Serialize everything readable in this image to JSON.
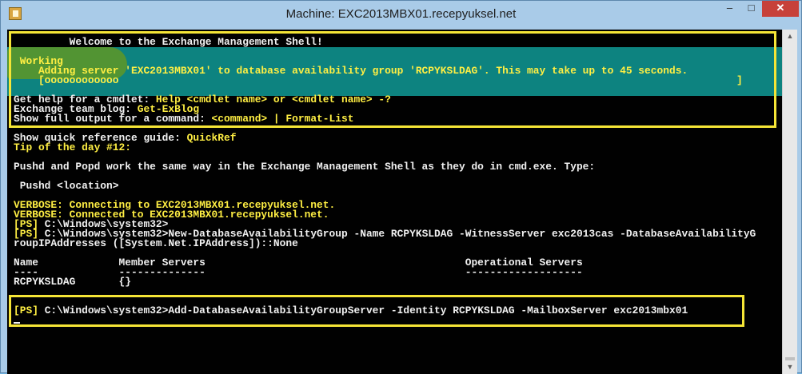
{
  "window": {
    "title": "Machine: EXC2013MBX01.recepyuksel.net",
    "minimize_icon": "minimize-icon",
    "maximize_icon": "maximize-icon",
    "close_icon": "close-icon"
  },
  "console": {
    "welcome": "         Welcome to the Exchange Management Shell!",
    "progress": {
      "status": " Working",
      "activity": "    Adding server 'EXC2013MBX01' to database availability group 'RCPYKSLDAG'. This may take up to 45 seconds.",
      "bar": "    [oooooooooooo",
      "bar_end": "]"
    },
    "help_lines": [
      {
        "label": "Get help for a cmdlet: ",
        "value": "Help <cmdlet name> or <cmdlet name> -?"
      },
      {
        "label": "Exchange team blog: ",
        "value": "Get-ExBlog"
      },
      {
        "label": "Show full output for a command: ",
        "value": "<command> | Format-List"
      }
    ],
    "quickref": {
      "label": "Show quick reference guide: ",
      "value": "QuickRef"
    },
    "tip_title": "Tip of the day #12:",
    "tip_text": "Pushd and Popd work the same way in the Exchange Management Shell as they do in cmd.exe. Type:",
    "tip_example": " Pushd <location>",
    "verbose": [
      "VERBOSE: Connecting to EXC2013MBX01.recepyuksel.net.",
      "VERBOSE: Connected to EXC2013MBX01.recepyuksel.net."
    ],
    "prompt_tag": "[PS]",
    "prompt_path": " C:\\Windows\\system32>",
    "command1": "New-DatabaseAvailabilityGroup -Name RCPYKSLDAG -WitnessServer exc2013cas -DatabaseAvailabilityG",
    "command1_wrap": "roupIPAddresses ([System.Net.IPAddress])::None",
    "table": {
      "headers": "Name             Member Servers                                          Operational Servers",
      "underline": "----             --------------                                          -------------------",
      "row": "RCPYKSLDAG       {}"
    },
    "command2": "Add-DatabaseAvailabilityGroupServer -Identity RCPYKSLDAG -MailboxServer exc2013mbx01"
  },
  "colors": {
    "console_bg": "#010101",
    "progress_bg": "#0d8380",
    "highlight": "#f5e536",
    "text_yellow": "#ffef43",
    "text_white": "#f1f1f1"
  }
}
